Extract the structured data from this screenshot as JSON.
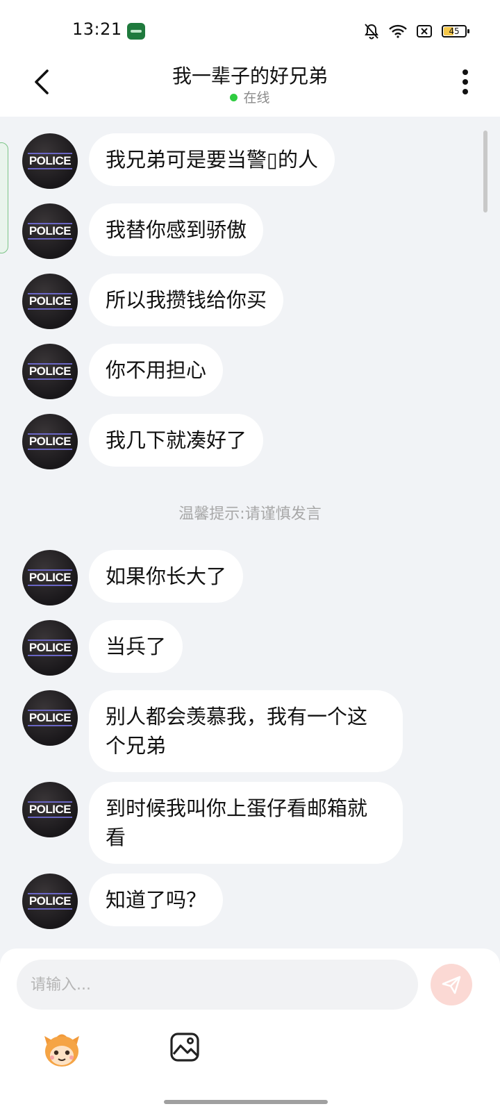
{
  "status_bar": {
    "time": "13:21",
    "battery": "45"
  },
  "header": {
    "title": "我一辈子的好兄弟",
    "status": "在线"
  },
  "avatar_label": "POLICE",
  "messages": [
    {
      "text": "我兄弟可是要当警▯的人"
    },
    {
      "text": "我替你感到骄傲"
    },
    {
      "text": "所以我攒钱给你买"
    },
    {
      "text": "你不用担心"
    },
    {
      "text": "我几下就凑好了"
    },
    {
      "text": "如果你长大了"
    },
    {
      "text": "当兵了"
    },
    {
      "text": "别人都会羡慕我，我有一个这个兄弟"
    },
    {
      "text": "到时候我叫你上蛋仔看邮箱就看"
    },
    {
      "text": "知道了吗？"
    }
  ],
  "hint": "温馨提示:请谨慎发言",
  "composer": {
    "placeholder": "请输入..."
  },
  "colors": {
    "background": "#f1f3f6",
    "bubble": "#ffffff",
    "online_dot": "#2ecc40",
    "send_button": "#fbd9d4"
  },
  "icons": [
    "back-arrow-icon",
    "more-vertical-icon",
    "send-icon",
    "mascot-icon",
    "image-icon",
    "bell-muted-icon",
    "wifi-icon",
    "sim-icon",
    "battery-icon"
  ]
}
